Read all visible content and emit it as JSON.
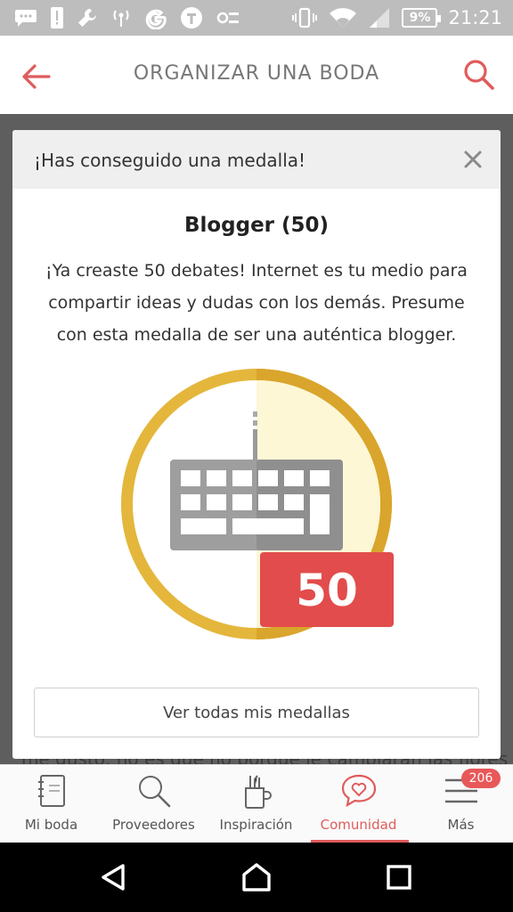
{
  "status_bar": {
    "battery": "9%",
    "time": "21:21",
    "icons": [
      "chat-icon",
      "alert-icon",
      "wrench-icon",
      "radio-icon",
      "google-icon",
      "t-icon",
      "settings-toggle-icon",
      "vibrate-icon",
      "wifi-icon",
      "signal-icon",
      "battery-icon"
    ]
  },
  "app_bar": {
    "title": "ORGANIZAR UNA BODA",
    "accent_color": "#e05b5b"
  },
  "background": {
    "partial_text": "me gustó, no es que no porque le cambiaran las flores"
  },
  "dialog": {
    "title": "¡Has conseguido una medalla!",
    "medal_name": "Blogger (50)",
    "description": "¡Ya creaste 50 debates! Internet es tu medio para compartir ideas y dudas con los demás. Presume con esta medalla de ser una auténtica blogger.",
    "badge": {
      "icon": "keyboard-icon",
      "number": "50",
      "ring_color": "#e3b53a",
      "tag_color": "#e24c4c"
    },
    "view_all_label": "Ver todas mis medallas"
  },
  "bottom_nav": {
    "items": [
      {
        "label": "Mi boda",
        "icon": "notebook-icon"
      },
      {
        "label": "Proveedores",
        "icon": "search-icon"
      },
      {
        "label": "Inspiración",
        "icon": "pencil-cup-icon"
      },
      {
        "label": "Comunidad",
        "icon": "heart-chat-icon",
        "active": true
      },
      {
        "label": "Más",
        "icon": "menu-icon",
        "badge": "206"
      }
    ]
  }
}
